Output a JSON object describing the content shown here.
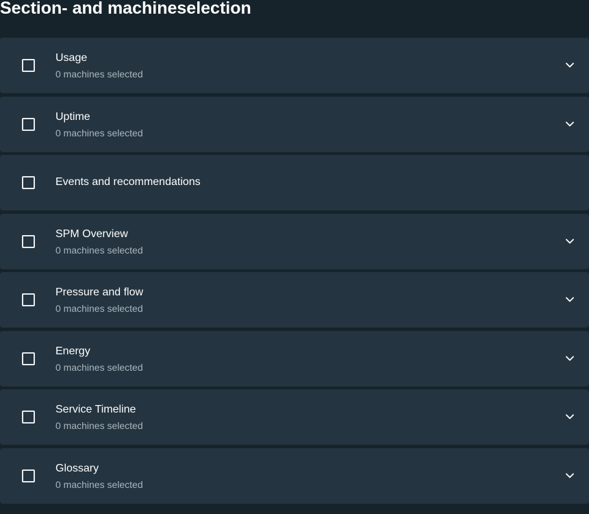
{
  "page": {
    "title": "Section- and machineselection"
  },
  "colors": {
    "background": "#17232b",
    "card": "#243440",
    "subtitle": "#aab6be",
    "text": "#ffffff"
  },
  "sections": [
    {
      "title": "Usage",
      "subtitle": "0 machines selected",
      "checked": false,
      "expandable": true
    },
    {
      "title": "Uptime",
      "subtitle": "0 machines selected",
      "checked": false,
      "expandable": true
    },
    {
      "title": "Events and recommendations",
      "subtitle": null,
      "checked": false,
      "expandable": false
    },
    {
      "title": "SPM Overview",
      "subtitle": "0 machines selected",
      "checked": false,
      "expandable": true
    },
    {
      "title": "Pressure and flow",
      "subtitle": "0 machines selected",
      "checked": false,
      "expandable": true
    },
    {
      "title": "Energy",
      "subtitle": "0 machines selected",
      "checked": false,
      "expandable": true
    },
    {
      "title": "Service Timeline",
      "subtitle": "0 machines selected",
      "checked": false,
      "expandable": true
    },
    {
      "title": "Glossary",
      "subtitle": "0 machines selected",
      "checked": false,
      "expandable": true
    }
  ],
  "icons": {
    "checkbox": "checkbox-unchecked-icon",
    "expand": "chevron-down-icon"
  }
}
